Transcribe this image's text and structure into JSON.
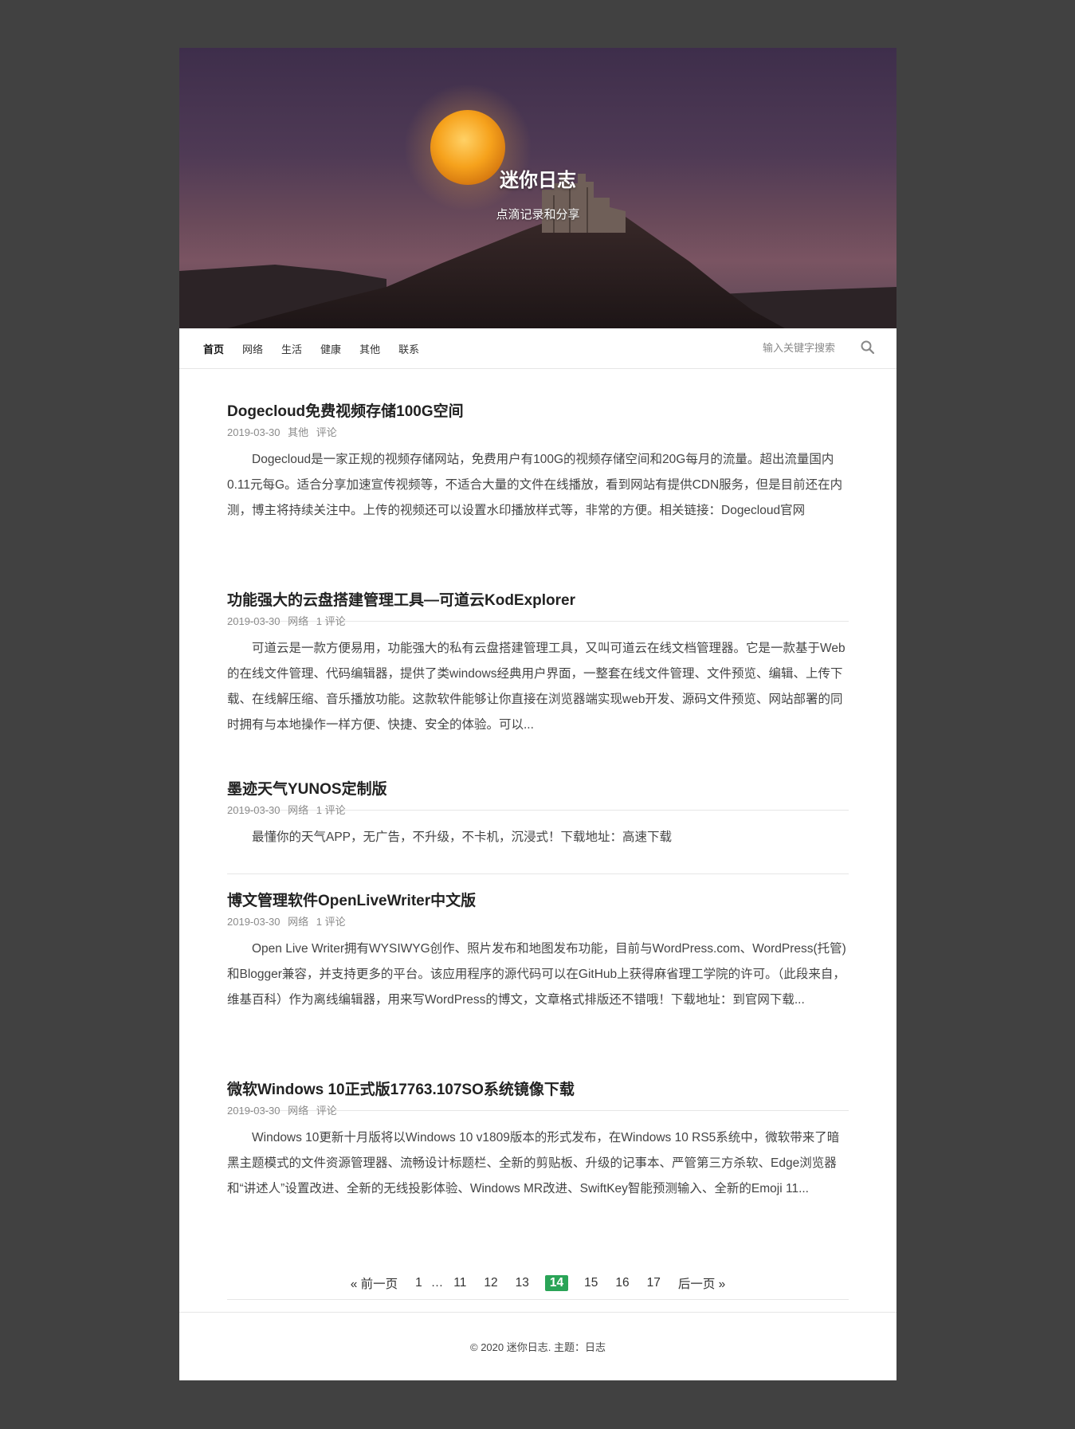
{
  "header": {
    "site_title": "迷你日志",
    "site_description": "点滴记录和分享"
  },
  "nav": {
    "items": [
      {
        "label": "首页",
        "active": true
      },
      {
        "label": "网络"
      },
      {
        "label": "生活"
      },
      {
        "label": "健康"
      },
      {
        "label": "其他"
      },
      {
        "label": "联系"
      }
    ],
    "search_placeholder": "输入关键字搜索",
    "search_icon": "search-icon"
  },
  "posts": [
    {
      "title": "Dogecloud免费视频存储100G空间",
      "date": "2019-03-30",
      "category": "其他",
      "comments": "评论",
      "excerpt": "Dogecloud是一家正规的视频存储网站，免费用户有100G的视频存储空间和20G每月的流量。超出流量国内0.11元每G。适合分享加速宣传视频等，不适合大量的文件在线播放，看到网站有提供CDN服务，但是目前还在内测，博主将持续关注中。上传的视频还可以设置水印播放样式等，非常的方便。相关链接：Dogecloud官网"
    },
    {
      "title": "功能强大的云盘搭建管理工具—可道云KodExplorer",
      "date": "2019-03-30",
      "category": "网络",
      "comments": "1 评论",
      "excerpt": "可道云是一款方便易用，功能强大的私有云盘搭建管理工具，又叫可道云在线文档管理器。它是一款基于Web的在线文件管理、代码编辑器，提供了类windows经典用户界面，一整套在线文件管理、文件预览、编辑、上传下载、在线解压缩、音乐播放功能。这款软件能够让你直接在浏览器端实现web开发、源码文件预览、网站部署的同时拥有与本地操作一样方便、快捷、安全的体验。可以..."
    },
    {
      "title": "墨迹天气YUNOS定制版",
      "date": "2019-03-30",
      "category": "网络",
      "comments": "1 评论",
      "excerpt": "最懂你的天气APP，无广告，不升级，不卡机，沉浸式！下载地址：高速下载"
    },
    {
      "title": "博文管理软件OpenLiveWriter中文版",
      "date": "2019-03-30",
      "category": "网络",
      "comments": "1 评论",
      "excerpt": "Open Live Writer拥有WYSIWYG创作、照片发布和地图发布功能，目前与WordPress.com、WordPress(托管)和Blogger兼容，并支持更多的平台。该应用程序的源代码可以在GitHub上获得麻省理工学院的许可。（此段来自，维基百科）作为离线编辑器，用来写WordPress的博文，文章格式排版还不错哦！下载地址：到官网下载..."
    },
    {
      "title": "微软Windows 10正式版17763.107SO系统镜像下载",
      "date": "2019-03-30",
      "category": "网络",
      "comments": "评论",
      "excerpt": "Windows 10更新十月版将以Windows 10 v1809版本的形式发布，在Windows 10 RS5系统中，微软带来了暗黑主题模式的文件资源管理器、流畅设计标题栏、全新的剪贴板、升级的记事本、严管第三方杀软、Edge浏览器和“讲述人”设置改进、全新的无线投影体验、Windows MR改进、SwiftKey智能预测输入、全新的Emoji 11..."
    }
  ],
  "pagination": {
    "prev": "« 前一页",
    "next": "后一页 »",
    "dots": "…",
    "pages": [
      "1",
      "11",
      "12",
      "13",
      "14",
      "15",
      "16",
      "17"
    ],
    "current": "14"
  },
  "footer": {
    "copyright": "© 2020 迷你日志. 主题：",
    "theme_link": "日志"
  },
  "colors": {
    "page_background": "#414141",
    "accent_green": "#2aa457"
  }
}
